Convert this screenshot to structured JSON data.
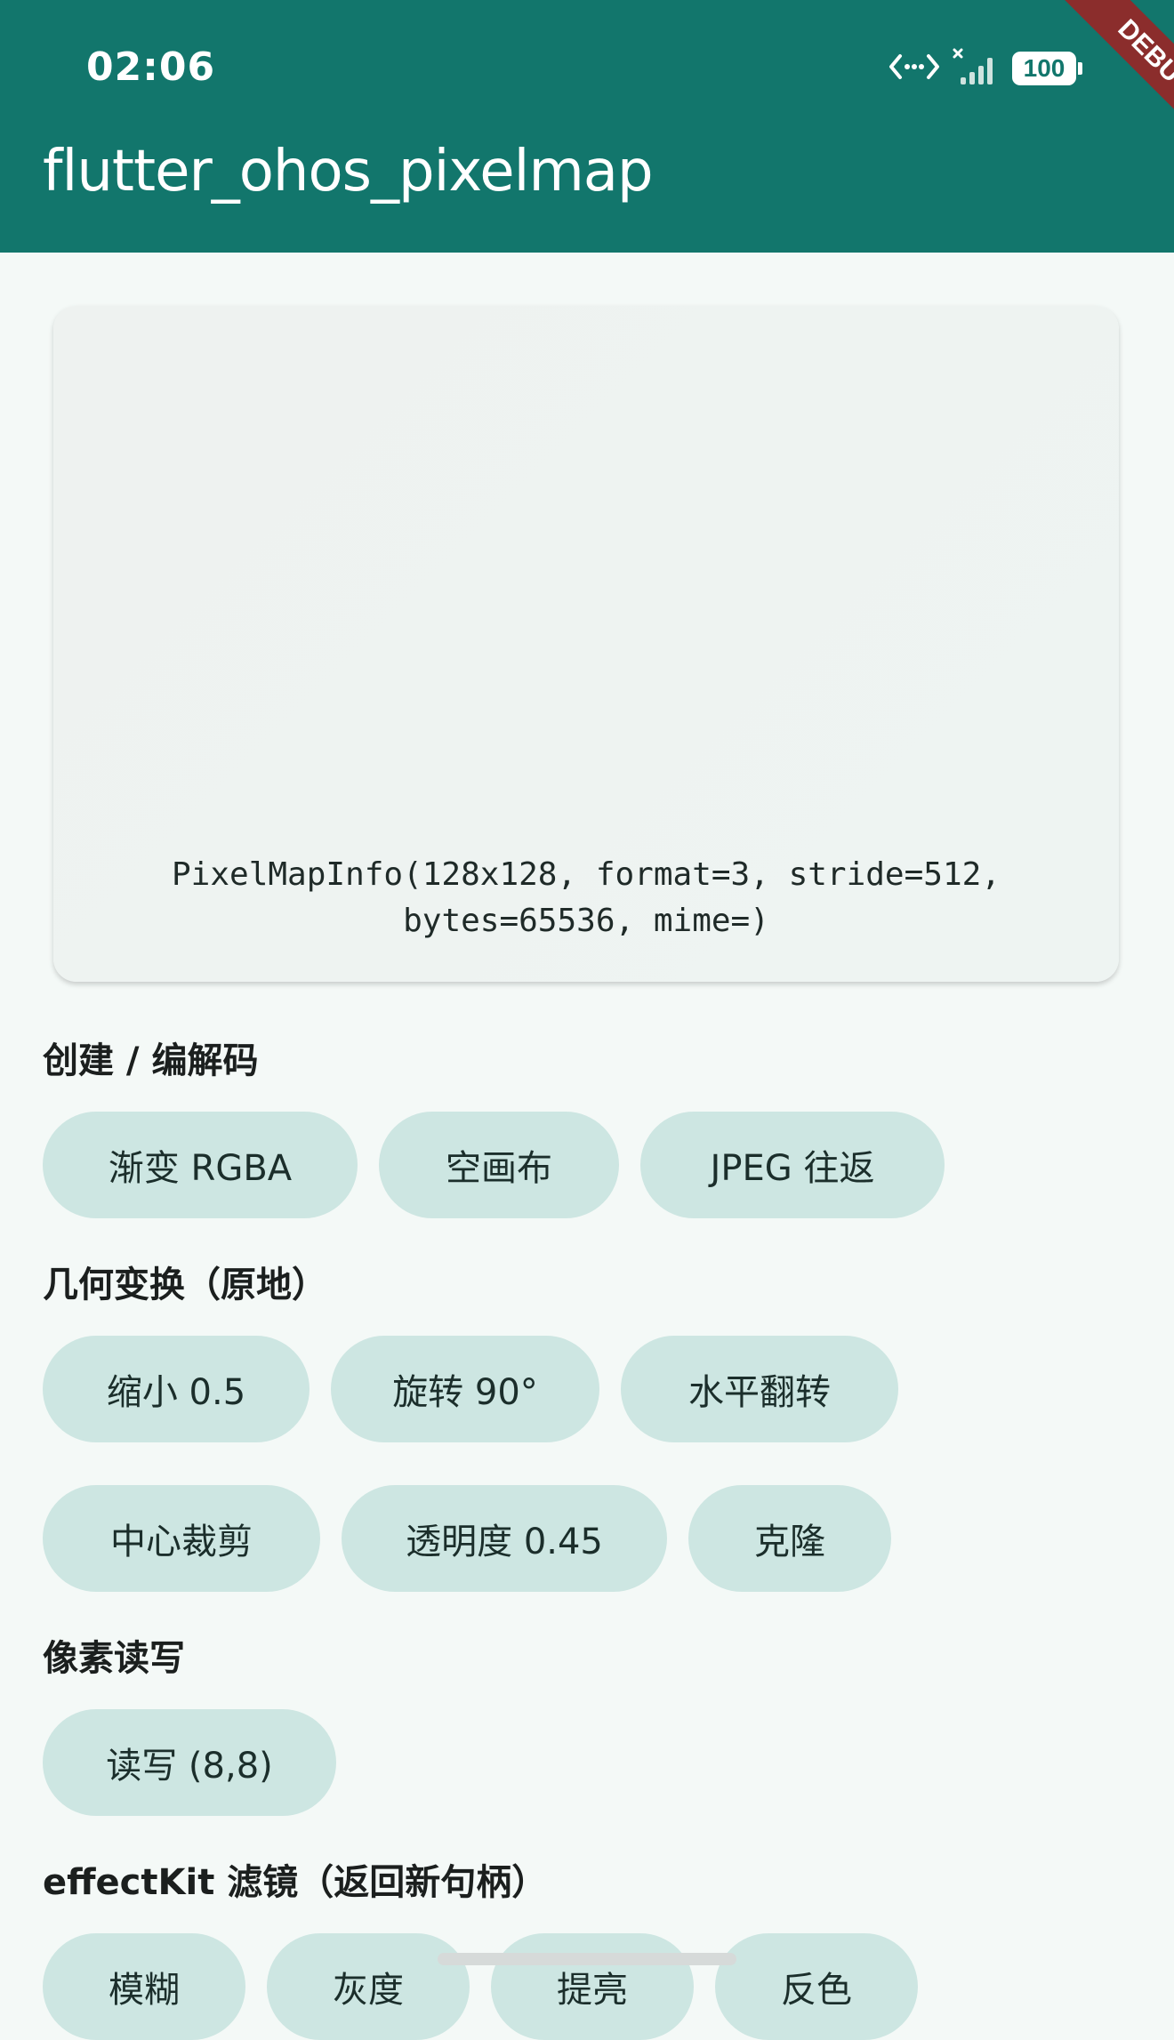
{
  "status_bar": {
    "time": "02:06",
    "battery": "100"
  },
  "app_bar": {
    "title": "flutter_ohos_pixelmap",
    "debug_label": "DEBUG"
  },
  "preview": {
    "info_line1": "PixelMapInfo(128x128, format=3, stride=512,",
    "info_line2": "bytes=65536, mime=)"
  },
  "sections": [
    {
      "title": "创建 / 编解码",
      "buttons": [
        "渐变 RGBA",
        "空画布",
        "JPEG 往返"
      ]
    },
    {
      "title": "几何变换（原地）",
      "buttons": [
        "缩小 0.5",
        "旋转 90°",
        "水平翻转",
        "中心裁剪",
        "透明度 0.45",
        "克隆"
      ]
    },
    {
      "title": "像素读写",
      "buttons": [
        "读写 (8,8)"
      ]
    },
    {
      "title": "effectKit 滤镜（返回新句柄）",
      "buttons": [
        "模糊",
        "灰度",
        "提亮",
        "反色"
      ]
    }
  ],
  "colors": {
    "app_bar": "#12766c",
    "chip_bg": "#cde6e2",
    "page_bg": "#f4f9f7",
    "debug_ribbon": "#8b2d2c"
  }
}
